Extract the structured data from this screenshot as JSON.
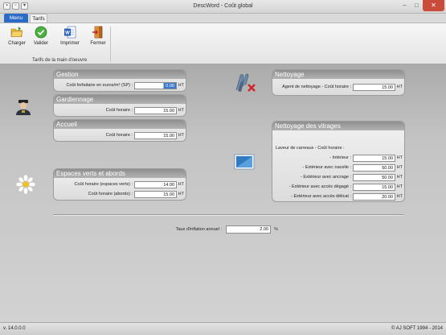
{
  "window": {
    "title": "DescWord - Coût global"
  },
  "tabs": [
    {
      "label": "Menu"
    },
    {
      "label": "Tarifs"
    }
  ],
  "ribbon": {
    "buttons": [
      {
        "label": "Charger",
        "icon": "folder-open-icon"
      },
      {
        "label": "Valider",
        "icon": "check-circle-icon"
      },
      {
        "label": "Imprimer",
        "icon": "word-document-icon"
      },
      {
        "label": "Fermer",
        "icon": "exit-door-icon"
      }
    ],
    "group_label": "Tarifs de la main d'oeuvre"
  },
  "gestion": {
    "title": "Gestion",
    "rows": [
      {
        "label": "Coût forfaitaire en euros/m² (SP) :",
        "value": "0.00",
        "unit": "HT"
      }
    ]
  },
  "gardiennage": {
    "title": "Gardiennage",
    "rows": [
      {
        "label": "Coût horaire :",
        "value": "15.00",
        "unit": "HT"
      }
    ]
  },
  "accueil": {
    "title": "Accueil",
    "rows": [
      {
        "label": "Coût horaire :",
        "value": "15.00",
        "unit": "HT"
      }
    ]
  },
  "espaces": {
    "title": "Espaces verts et abords",
    "rows": [
      {
        "label": "Coût horaire (espaces verts) :",
        "value": "14.00",
        "unit": "HT"
      },
      {
        "label": "Coût horaire (abords) :",
        "value": "15.00",
        "unit": "HT"
      }
    ]
  },
  "nettoyage": {
    "title": "Nettoyage",
    "rows": [
      {
        "label": "Agent de nettoyage - Coût horaire :",
        "value": "15.00",
        "unit": "HT"
      }
    ]
  },
  "vitrages": {
    "title": "Nettoyage des vitrages",
    "heading": "Laveur de carreaux - Coût horaire :",
    "rows": [
      {
        "label": "- Intérieur :",
        "value": "15.00",
        "unit": "HT"
      },
      {
        "label": "- Extérieur avec nacelle :",
        "value": "50.00",
        "unit": "HT"
      },
      {
        "label": "- Extérieur avec ancrage :",
        "value": "50.00",
        "unit": "HT"
      },
      {
        "label": "- Extérieur avec accès dégagé :",
        "value": "15.00",
        "unit": "HT"
      },
      {
        "label": "- Extérieur avec accès délicat :",
        "value": "20.00",
        "unit": "HT"
      }
    ]
  },
  "inflation": {
    "label": "Taux d'inflation annuel :",
    "value": "2.00",
    "unit": "%"
  },
  "status": {
    "version": "v. 14.0.0.0",
    "copyright": "© AJ SOFT 1994 - 2014"
  },
  "colors": {
    "accent": "#2a6bc8",
    "section_header": "#9e9e9e",
    "close_button": "#c94b3c"
  }
}
